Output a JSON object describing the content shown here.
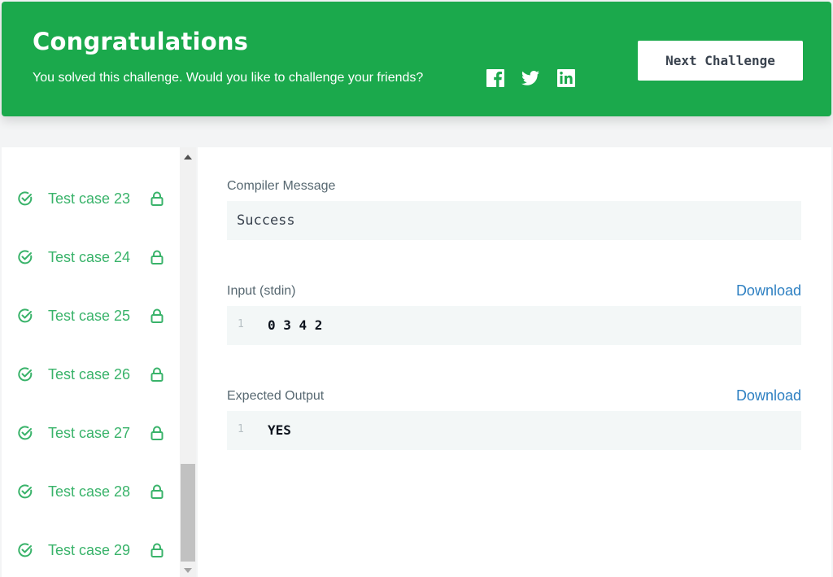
{
  "banner": {
    "title": "Congratulations",
    "subtitle": "You solved this challenge. Would you like to challenge your friends?",
    "social": [
      "facebook-icon",
      "twitter-icon",
      "linkedin-icon"
    ],
    "next_button": "Next Challenge",
    "color": "#1ba94c"
  },
  "sidebar": {
    "test_cases": [
      {
        "label": "Test case 23",
        "status": "passed",
        "locked": true
      },
      {
        "label": "Test case 24",
        "status": "passed",
        "locked": true
      },
      {
        "label": "Test case 25",
        "status": "passed",
        "locked": true
      },
      {
        "label": "Test case 26",
        "status": "passed",
        "locked": true
      },
      {
        "label": "Test case 27",
        "status": "passed",
        "locked": true
      },
      {
        "label": "Test case 28",
        "status": "passed",
        "locked": true
      },
      {
        "label": "Test case 29",
        "status": "passed",
        "locked": true
      }
    ],
    "accent": "#39b36a"
  },
  "main": {
    "compiler": {
      "label": "Compiler Message",
      "value": "Success"
    },
    "input": {
      "label": "Input (stdin)",
      "download": "Download",
      "line_number": "1",
      "value": "0 3 4 2"
    },
    "expected": {
      "label": "Expected Output",
      "download": "Download",
      "line_number": "1",
      "value": "YES"
    }
  }
}
